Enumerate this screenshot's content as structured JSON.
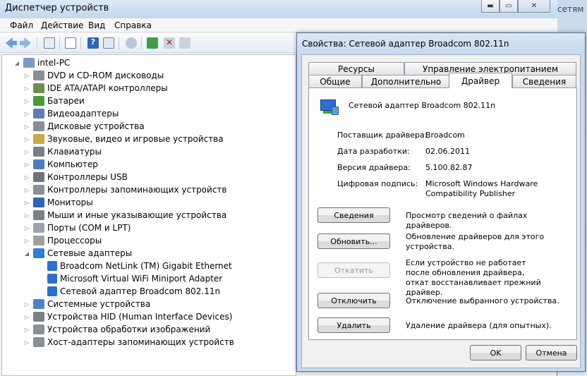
{
  "bg": {
    "partial_text": "сетям"
  },
  "main": {
    "title": "Диспетчер устройств",
    "menu": [
      "Файл",
      "Действие",
      "Вид",
      "Справка"
    ],
    "tree": {
      "root": "intel-PC",
      "categories": [
        "DVD и CD-ROM дисководы",
        "IDE ATA/ATAPI контроллеры",
        "Батареи",
        "Видеоадаптеры",
        "Дисковые устройства",
        "Звуковые, видео и игровые устройства",
        "Клавиатуры",
        "Компьютер",
        "Контроллеры USB",
        "Контроллеры запоминающих устройств",
        "Мониторы",
        "Мыши и иные указывающие устройства",
        "Порты (COM и LPT)",
        "Процессоры",
        "Сетевые адаптеры",
        "Системные устройства",
        "Устройства HID (Human Interface Devices)",
        "Устройства обработки изображений",
        "Хост-адаптеры запоминающих устройств"
      ],
      "network_children": [
        "Broadcom NetLink (TM) Gigabit Ethernet",
        "Microsoft Virtual WiFi Miniport Adapter",
        "Сетевой адаптер Broadcom 802.11n"
      ]
    }
  },
  "dialog": {
    "title": "Свойства: Сетевой адаптер Broadcom 802.11n",
    "tabs_top": [
      "Ресурсы",
      "Управление электропитанием"
    ],
    "tabs_bottom": [
      "Общие",
      "Дополнительно",
      "Драйвер",
      "Сведения"
    ],
    "device_name": "Сетевой адаптер Broadcom 802.11n",
    "info": [
      {
        "label": "Поставщик драйвера:",
        "value": "Broadcom"
      },
      {
        "label": "Дата разработки:",
        "value": "02.06.2011"
      },
      {
        "label": "Версия драйвера:",
        "value": "5.100.82.87"
      },
      {
        "label": "Цифровая подпись:",
        "value": "Microsoft Windows Hardware Compatibility Publisher"
      }
    ],
    "actions": [
      {
        "button": "Сведения",
        "desc": "Просмотр сведений о файлах драйверов.",
        "disabled": false
      },
      {
        "button": "Обновить...",
        "desc": "Обновление драйверов для этого устройства.",
        "disabled": false
      },
      {
        "button": "Откатить",
        "desc": "Если устройство не работает после обновления драйвера, откат восстанавливает прежний драйвер.",
        "disabled": true
      },
      {
        "button": "Отключить",
        "desc": "Отключение выбранного устройства.",
        "disabled": false
      },
      {
        "button": "Удалить",
        "desc": "Удаление драйвера (для опытных).",
        "disabled": false
      }
    ],
    "ok": "OK",
    "cancel": "Отмена"
  }
}
